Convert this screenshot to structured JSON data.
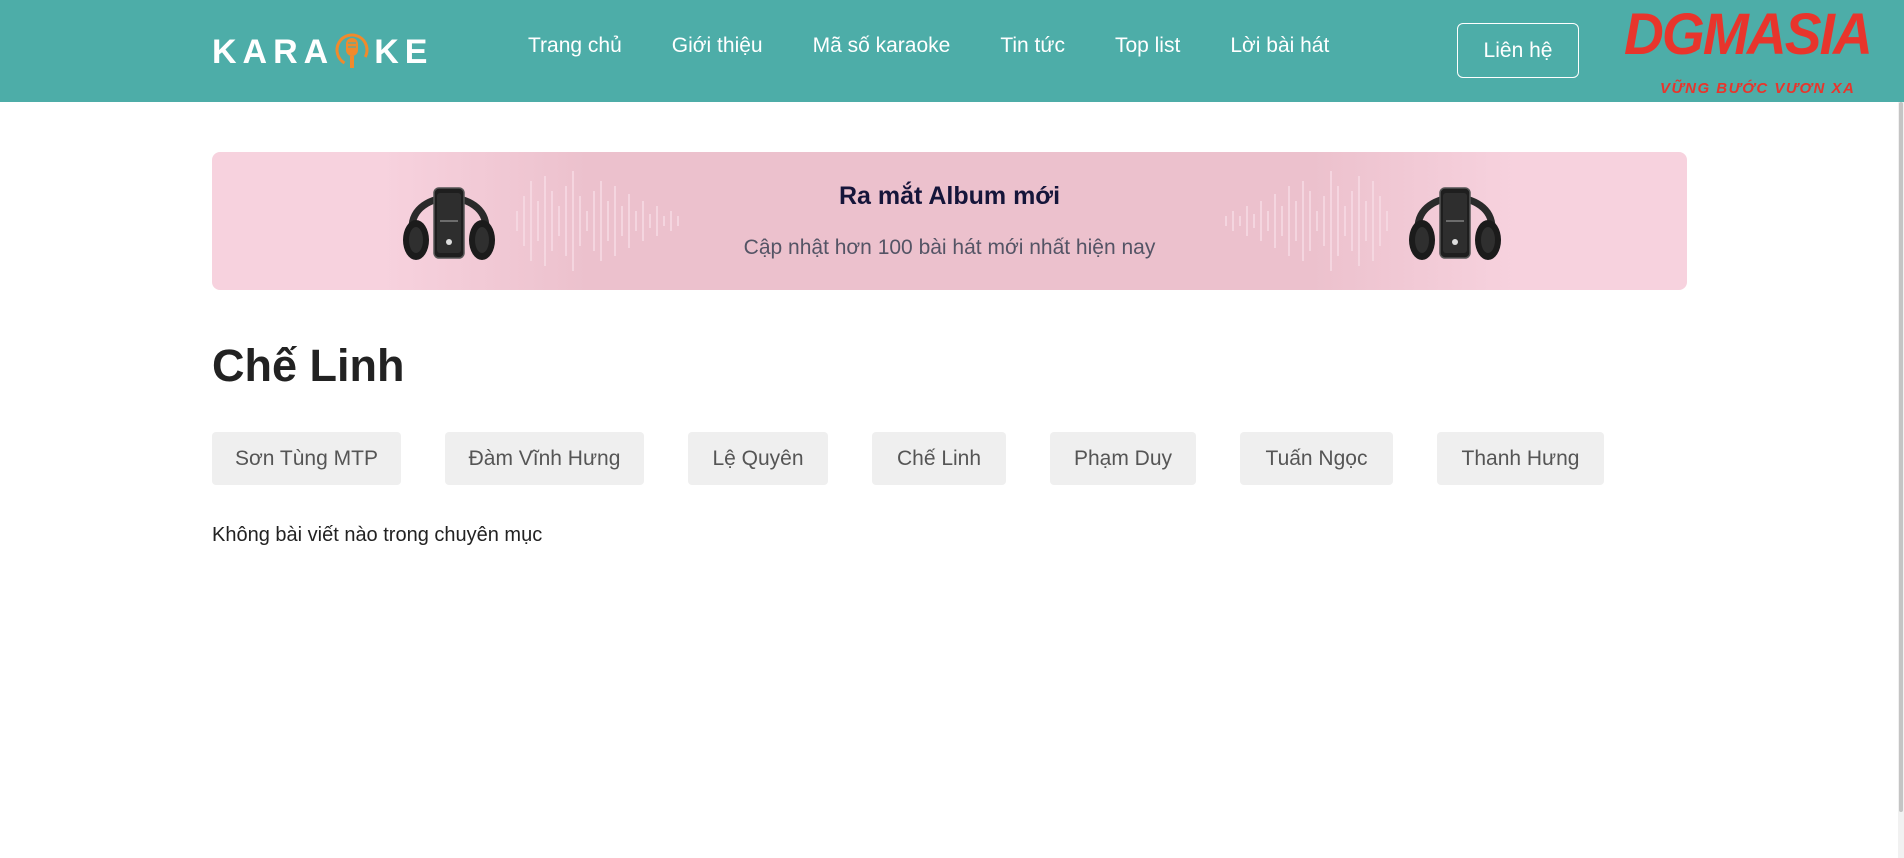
{
  "header": {
    "logo_text_left": "KARA",
    "logo_text_right": "KE",
    "nav": [
      {
        "label": "Trang chủ"
      },
      {
        "label": "Giới thiệu"
      },
      {
        "label": "Mã số karaoke"
      },
      {
        "label": "Tin tức"
      },
      {
        "label": "Top list"
      },
      {
        "label": "Lời bài hát"
      }
    ],
    "contact_label": "Liên hệ",
    "brand": {
      "main": "DGMASIA",
      "sub": "VỮNG BƯỚC VƯƠN XA"
    }
  },
  "banner": {
    "title": "Ra mắt Album mới",
    "subtitle": "Cập nhật hơn 100 bài hát mới nhất hiện nay"
  },
  "page_title": "Chế Linh",
  "chips": [
    {
      "label": "Sơn Tùng MTP"
    },
    {
      "label": "Đàm Vĩnh Hưng"
    },
    {
      "label": "Lệ Quyên"
    },
    {
      "label": "Chế Linh"
    },
    {
      "label": "Phạm Duy"
    },
    {
      "label": "Tuấn Ngọc"
    },
    {
      "label": "Thanh Hưng"
    }
  ],
  "empty_message": "Không bài viết nào trong chuyên mục",
  "colors": {
    "header_bg": "#4dada8",
    "banner_bg": "#f7d2de",
    "brand_red": "#e8352c",
    "mic_orange": "#f08a2c",
    "chip_bg": "#efefef"
  }
}
